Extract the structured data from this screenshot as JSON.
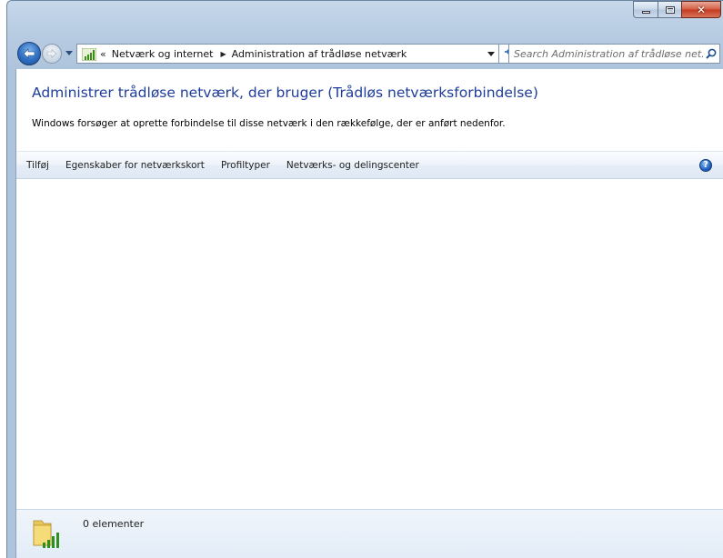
{
  "window": {
    "caption_buttons": {
      "minimize": "minimize-icon",
      "maximize": "maximize-icon",
      "close": "close-icon"
    }
  },
  "nav": {
    "back_icon": "back-arrow-icon",
    "forward_icon": "forward-arrow-icon",
    "address": {
      "icon": "wireless-network-icon",
      "overflow_chevron": "«",
      "crumbs": [
        "Netværk og internet",
        "Administration af trådløse netværk"
      ]
    },
    "search": {
      "placeholder": "Search Administration af trådløse net..."
    }
  },
  "main": {
    "title": "Administrer trådløse netværk, der bruger (Trådløs netværksforbindelse)",
    "description": "Windows forsøger at oprette forbindelse til disse netværk i den rækkefølge, der er anført nedenfor."
  },
  "toolbar": {
    "items": [
      "Tilføj",
      "Egenskaber for netværkskort",
      "Profiltyper",
      "Netværks- og delingscenter"
    ],
    "help_icon": "help-icon",
    "help_glyph": "?"
  },
  "status": {
    "icon": "wireless-folder-icon",
    "text": "0 elementer"
  },
  "colors": {
    "title_blue": "#1e3d9a",
    "frame_blue": "#b9cde3",
    "close_red": "#c3391f"
  }
}
